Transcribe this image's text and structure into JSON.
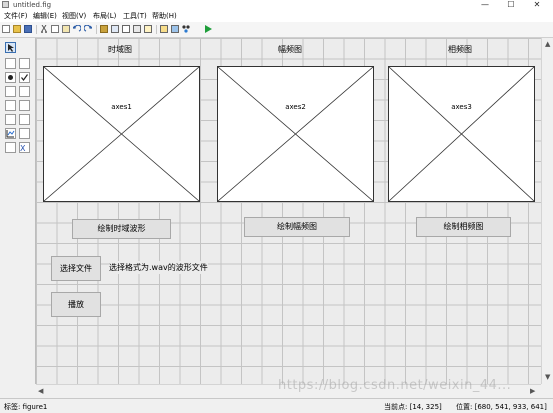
{
  "window": {
    "title": "untitled.fig",
    "min_label": "—",
    "max_label": "☐",
    "close_label": "✕"
  },
  "menu": [
    "文件(F)",
    "编辑(E)",
    "视图(V)",
    "布局(L)",
    "工具(T)",
    "帮助(H)"
  ],
  "canvas": {
    "panel_titles": [
      "时域图",
      "幅频图",
      "相频图"
    ],
    "axes": [
      "axes1",
      "axes2",
      "axes3"
    ],
    "buttons": {
      "time_plot": "绘制时域波形",
      "amp_plot": "绘制幅频图",
      "phase_plot": "绘制相频图",
      "select_file": "选择文件",
      "play": "播放"
    },
    "hint_text": "选择格式为.wav的波形文件"
  },
  "status": {
    "tag": "标签: figure1",
    "current_point": "当前点:  [14, 325]",
    "position": "位置: [680, 541, 933, 641]"
  },
  "watermark": "https://blog.csdn.net/weixin_44...",
  "colors": {
    "grid": "#c4c4c4",
    "canvas": "#ececec",
    "run_green": "#1e9e3a"
  }
}
